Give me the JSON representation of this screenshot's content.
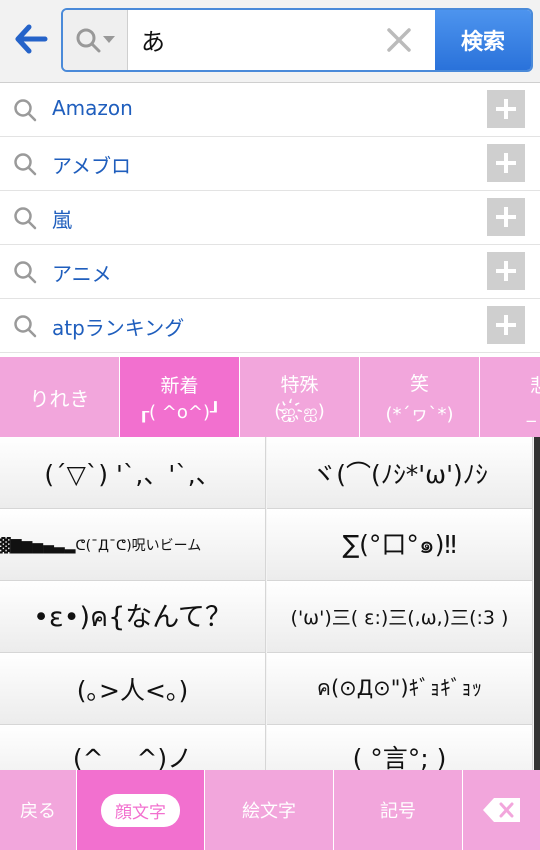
{
  "search": {
    "query": "あ",
    "button_label": "検索"
  },
  "suggestions": [
    {
      "label": "Amazon"
    },
    {
      "label": "アメブロ"
    },
    {
      "label": "嵐"
    },
    {
      "label": "アニメ"
    },
    {
      "label": "atpランキング"
    }
  ],
  "categories": [
    {
      "label": "りれき",
      "kaomoji": ""
    },
    {
      "label": "新着",
      "kaomoji": "┎( ^o^)┚"
    },
    {
      "label": "特殊",
      "kaomoji": "(ஐ҉ஐ)"
    },
    {
      "label": "笑",
      "kaomoji": "(*´ヮ`*)"
    },
    {
      "label": "悲",
      "kaomoji": "_ ┌"
    }
  ],
  "kaomoji": [
    "(´▽`) '`,、'`,、",
    "ヾ(⌒(ﾉｼ*'ω')ﾉｼ",
    "▓▇▆▅▄▃▂ᕦ(¯Д¯ᕦ)呪いビーム",
    "∑(°口°๑)‼",
    "•ε•)ค{なんて？",
    "('ω')三( ε:)三(,ω,)三(:3 )",
    "(｡>人<｡)",
    "ค(⊙Д⊙\")ｷﾞｮｷﾞｮｯ",
    "(^_ _^)ノ",
    "( °言°; )"
  ],
  "bottom": {
    "back": "戻る",
    "kaomoji": "顔文字",
    "emoji": "絵文字",
    "symbols": "記号"
  },
  "colors": {
    "accent_blue": "#2a72da",
    "pink": "#f2a6dc",
    "pink_active": "#f270cf"
  }
}
